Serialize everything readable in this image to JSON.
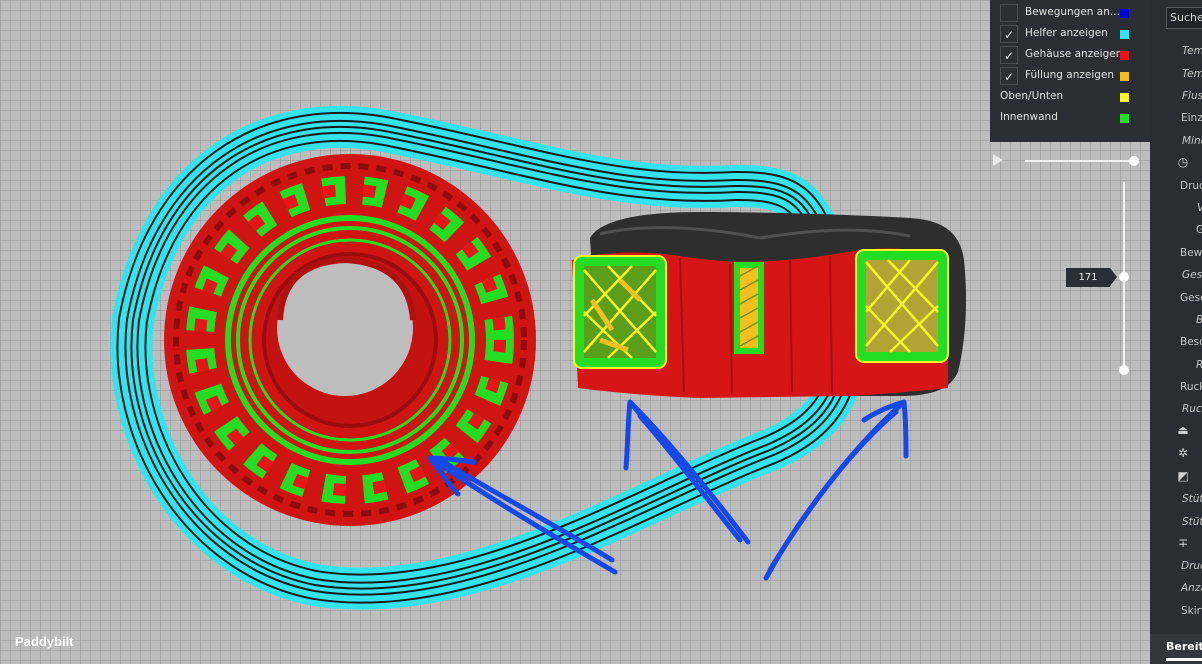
{
  "legend": {
    "items": [
      {
        "label": "Bewegungen an...",
        "checked": false,
        "color": "#0000dd"
      },
      {
        "label": "Helfer anzeigen",
        "checked": true,
        "color": "#33e4ee"
      },
      {
        "label": "Gehäuse anzeigen",
        "checked": true,
        "color": "#e8141a"
      },
      {
        "label": "Füllung anzeigen",
        "checked": true,
        "color": "#f0c020"
      },
      {
        "label": "Oben/Unten",
        "checked": null,
        "color": "#f5f528"
      },
      {
        "label": "Innenwand",
        "checked": null,
        "color": "#22dd22"
      }
    ]
  },
  "layer_slider": {
    "current_layer": "171"
  },
  "watermark": "Paddybilt",
  "sidebar": {
    "search_value": "Suchen",
    "items": [
      {
        "text": "Tem",
        "italic": true
      },
      {
        "text": "Tem",
        "italic": true
      },
      {
        "text": "Flus",
        "italic": true
      },
      {
        "text": "Einzu",
        "italic": false
      },
      {
        "text": "Mind",
        "italic": true
      },
      {
        "text": "Druc",
        "italic": false
      },
      {
        "text": "V",
        "italic": true
      },
      {
        "text": "G",
        "italic": false
      },
      {
        "text": "Bew",
        "italic": false
      },
      {
        "text": "Gesc",
        "italic": true
      },
      {
        "text": "Gesc",
        "italic": false
      },
      {
        "text": "B",
        "italic": true
      },
      {
        "text": "Besc",
        "italic": false
      },
      {
        "text": "R",
        "italic": true
      },
      {
        "text": "Ruck",
        "italic": false
      },
      {
        "text": "Ruck",
        "italic": true
      },
      {
        "text": "Stüt",
        "italic": true
      },
      {
        "text": "Stüt",
        "italic": true
      },
      {
        "text": "Druc",
        "italic": true
      },
      {
        "text": "Anza",
        "italic": true
      },
      {
        "text": "Skirt",
        "italic": false
      }
    ],
    "status": "Bereit"
  },
  "colors": {
    "helper": "#33e4ee",
    "shell": "#e8141a",
    "infill": "#f0c020",
    "top_bottom": "#f5f528",
    "inner_wall": "#22dd22",
    "annotation": "#1548e6"
  }
}
